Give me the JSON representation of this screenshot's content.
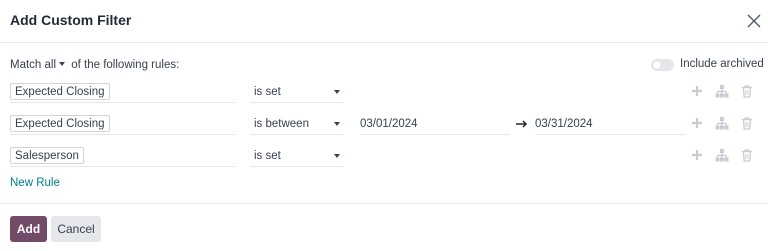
{
  "dialog": {
    "title": "Add Custom Filter",
    "close_icon": "close-icon"
  },
  "match": {
    "prefix": "Match",
    "selected": "all",
    "suffix": "of the following rules:"
  },
  "archived": {
    "label": "Include archived",
    "enabled": false
  },
  "rules": [
    {
      "field": "Expected Closing",
      "operator": "is set",
      "value": "",
      "value_end": ""
    },
    {
      "field": "Expected Closing",
      "operator": "is between",
      "value": "03/01/2024",
      "value_end": "03/31/2024"
    },
    {
      "field": "Salesperson",
      "operator": "is set",
      "value": "",
      "value_end": ""
    }
  ],
  "row_action_icons": [
    "plus-icon",
    "hierarchy-icon",
    "trash-icon"
  ],
  "new_rule_label": "New Rule",
  "footer": {
    "add_label": "Add",
    "cancel_label": "Cancel"
  },
  "colors": {
    "primary": "#714b67",
    "link": "#017e84",
    "secondary_button": "#e5e7eb",
    "border": "#e5e7eb",
    "icon_muted": "#c8ccd2"
  }
}
